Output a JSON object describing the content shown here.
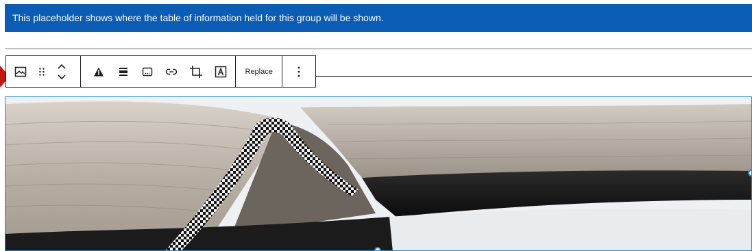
{
  "banner": {
    "text": "This placeholder shows where the table of information held for this group will be shown."
  },
  "toolbar": {
    "groups": [
      {
        "items": [
          "image-icon",
          "drag-handle-icon",
          "move-up-down-icon"
        ]
      },
      {
        "items": [
          "warning-triangle-icon",
          "align-icon",
          "caption-icon",
          "link-icon",
          "crop-icon",
          "text-overlay-icon"
        ]
      },
      {
        "items": [
          "replace-button"
        ]
      },
      {
        "items": [
          "more-options-icon"
        ]
      }
    ],
    "replace_label": "Replace"
  },
  "colors": {
    "banner_bg": "#0a5cb4",
    "selection_border": "#2a86c5",
    "marker": "#c41414"
  }
}
